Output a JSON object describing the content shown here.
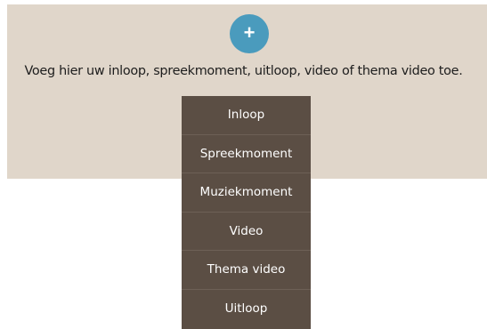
{
  "add_button": {
    "symbol": "+",
    "icon": "plus-icon",
    "color": "#4a9bbd"
  },
  "prompt": "Voeg hier uw inloop, spreekmoment, uitloop, video of thema video toe.",
  "menu": {
    "items": [
      "Inloop",
      "Spreekmoment",
      "Muziekmoment",
      "Video",
      "Thema video",
      "Uitloop"
    ]
  },
  "colors": {
    "panel_background": "#e0d6ca",
    "menu_background": "#5b4e44"
  }
}
